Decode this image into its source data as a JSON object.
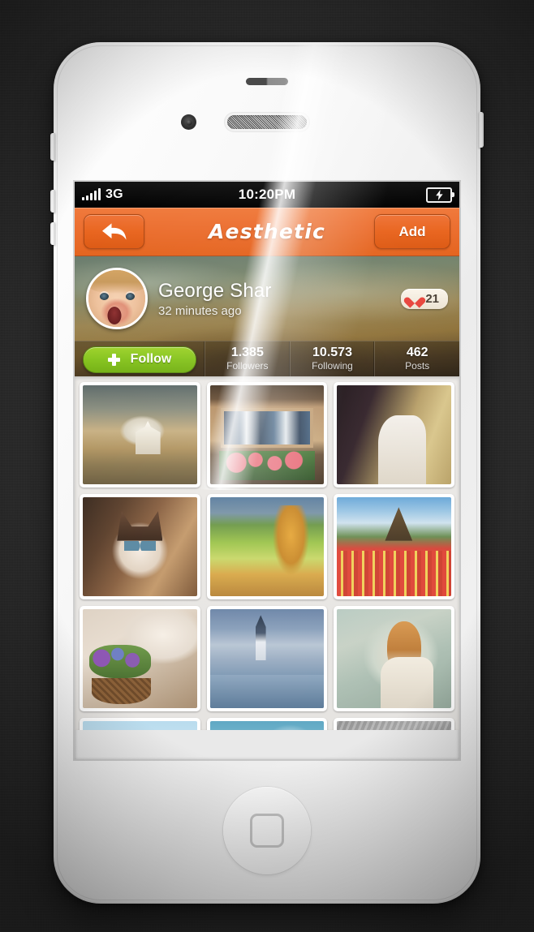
{
  "status_bar": {
    "carrier_network": "3G",
    "time": "10:20PM",
    "signal_icon": "signal-bars-icon",
    "battery_icon": "battery-charging-icon"
  },
  "nav_bar": {
    "title": "Aesthetic",
    "back_icon": "back-arrow-icon",
    "add_label": "Add"
  },
  "profile": {
    "name": "George Shar",
    "timestamp": "32 minutes ago",
    "avatar_icon": "user-avatar-photo",
    "likes": {
      "icon": "heart-icon",
      "count": "21"
    },
    "follow": {
      "label": "Follow",
      "icon": "plus-icon"
    },
    "stats": [
      {
        "value": "1.385",
        "label": "Followers"
      },
      {
        "value": "10.573",
        "label": "Following"
      },
      {
        "value": "462",
        "label": "Posts"
      }
    ]
  },
  "photo_grid": {
    "rows": [
      [
        {
          "name": "church-landscape-painting",
          "art": "ph-church"
        },
        {
          "name": "wooden-window-flowers",
          "art": "ph-window"
        },
        {
          "name": "woman-dark-hair-wheat",
          "art": "ph-hairgirl"
        }
      ],
      [
        {
          "name": "ragdoll-cat-portrait",
          "art": "ph-cat"
        },
        {
          "name": "autumn-green-hill",
          "art": "ph-hill"
        },
        {
          "name": "windmill-tulip-field",
          "art": "ph-windmill"
        }
      ],
      [
        {
          "name": "flower-basket",
          "art": "ph-basket"
        },
        {
          "name": "snowy-alpine-village",
          "art": "ph-village"
        },
        {
          "name": "redhead-woman-dress",
          "art": "ph-redhair"
        }
      ],
      [
        {
          "name": "hot-air-balloons-sky",
          "art": "ph-balloon"
        },
        {
          "name": "frosty-blue-scene",
          "art": "ph-frost"
        },
        {
          "name": "grey-texture-scene",
          "art": "ph-grey"
        }
      ]
    ]
  },
  "device": {
    "home_button_icon": "home-button-icon",
    "camera_icon": "front-camera-icon",
    "speaker_icon": "earpiece-speaker-icon"
  },
  "colors": {
    "accent_orange": "#ec6f30",
    "follow_green": "#86c41e",
    "heart_red": "#e8453c",
    "backdrop": "#272727"
  }
}
